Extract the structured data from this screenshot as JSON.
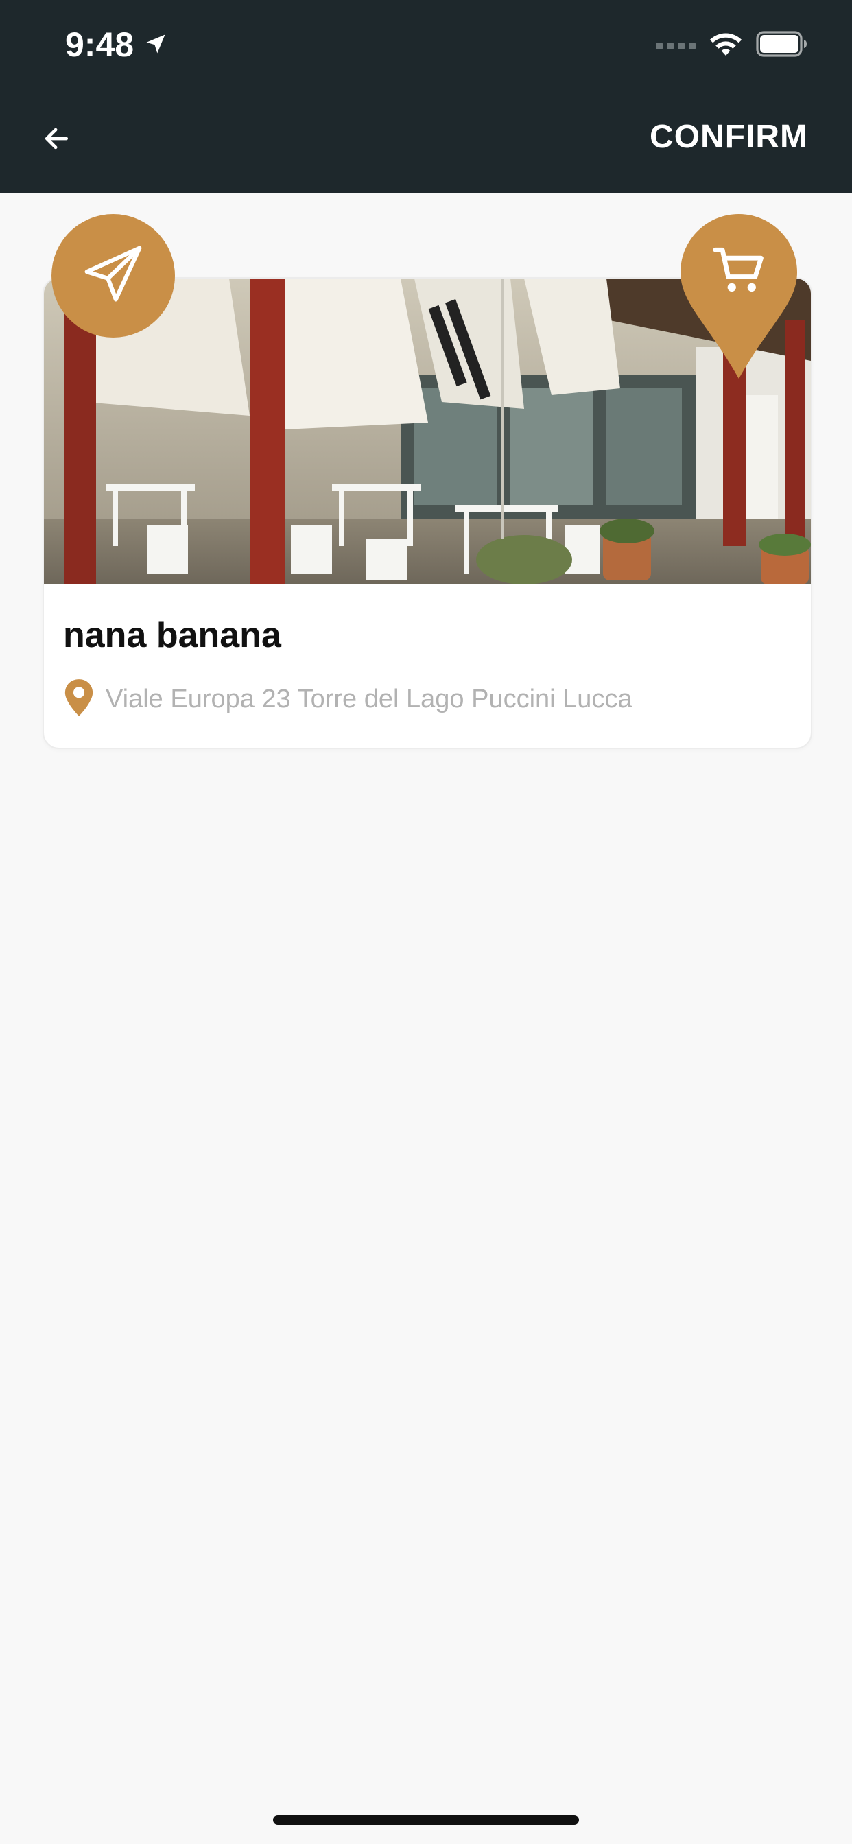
{
  "status_bar": {
    "time": "9:48",
    "location_icon": "location-arrow-icon",
    "wifi_icon": "wifi-icon",
    "battery_icon": "battery-icon"
  },
  "header": {
    "back_icon": "arrow-left-icon",
    "confirm_label": "CONFIRM"
  },
  "restaurant": {
    "name": "nana banana",
    "address": "Viale Europa 23 Torre del Lago Puccini Lucca",
    "address_icon": "map-pin-icon",
    "photo_label": "restaurant-photo"
  },
  "actions": {
    "send_icon": "paper-plane-icon",
    "cart_icon": "shopping-cart-icon"
  },
  "colors": {
    "header_bg": "#1e282c",
    "accent": "#c98f47",
    "page_bg": "#f8f8f8"
  }
}
